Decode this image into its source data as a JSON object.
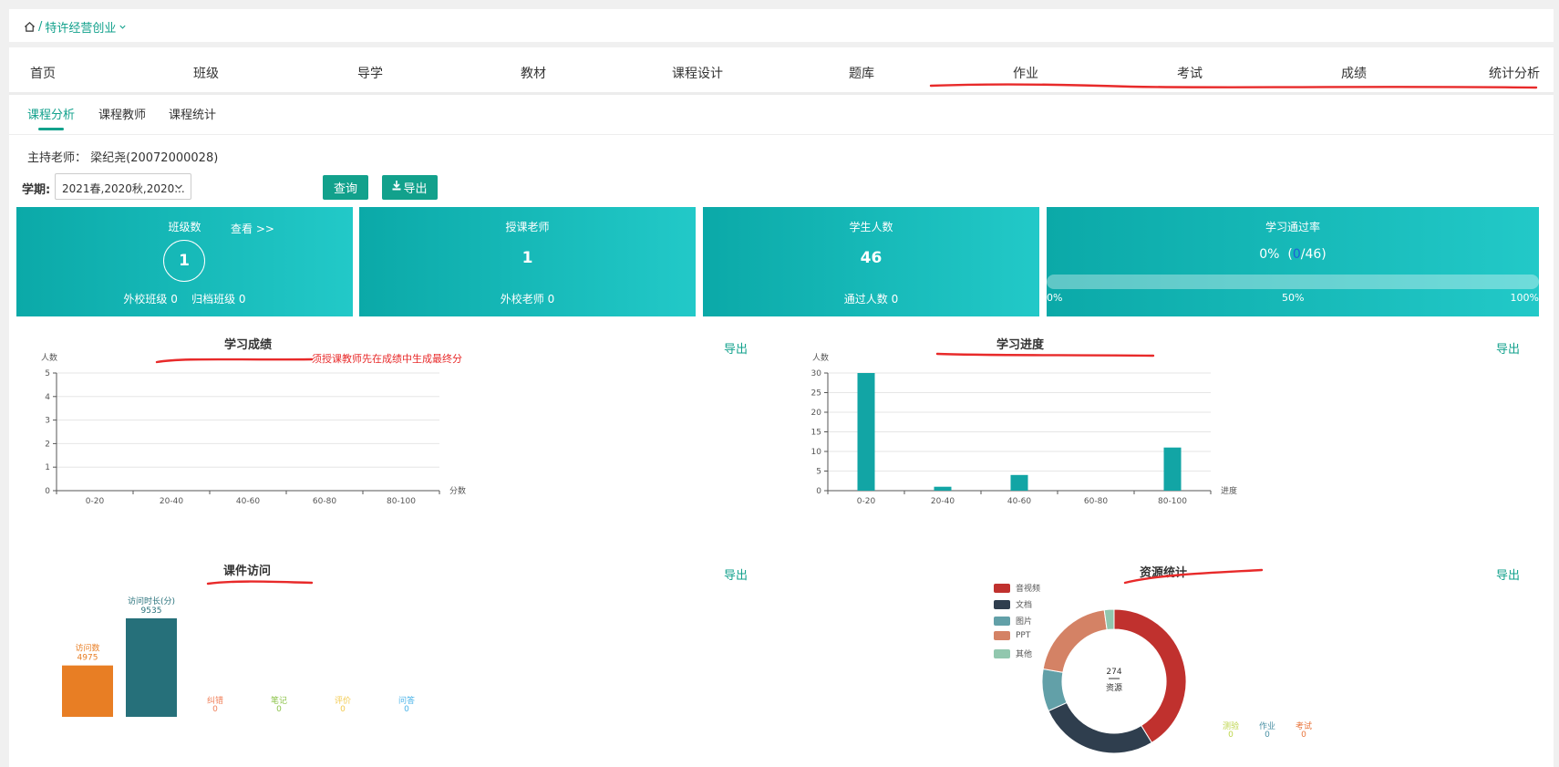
{
  "breadcrumb": {
    "separator": "/",
    "label": "特许经营创业"
  },
  "nav": [
    "首页",
    "班级",
    "导学",
    "教材",
    "课程设计",
    "题库",
    "作业",
    "考试",
    "成绩",
    "统计分析"
  ],
  "subnav": [
    "课程分析",
    "课程教师",
    "课程统计"
  ],
  "filters": {
    "host_label": "主持老师：",
    "host_value": "梁纪尧(20072000028)",
    "semester_label": "学期:",
    "semester_value": "2021春,2020秋,2020...",
    "query_button": "查询",
    "export_button": "导出"
  },
  "cards": {
    "classes": {
      "title": "班级数",
      "value": "1",
      "link": "查看 >>",
      "sub": "外校班级 0    归档班级 0"
    },
    "teachers": {
      "title": "授课老师",
      "value": "1",
      "sub": "外校老师 0"
    },
    "students": {
      "title": "学生人数",
      "value": "46",
      "sub": "通过人数 0"
    },
    "pass_rate": {
      "title": "学习通过率",
      "value_pre": "0%  (",
      "passed": "0",
      "value_post": "/46)",
      "ticks": [
        "0%",
        "50%",
        "100%"
      ],
      "progress": 0
    }
  },
  "charts": {
    "scores": {
      "title": "学习成绩",
      "export": "导出",
      "note": "须授课教师先在成绩中生成最终分"
    },
    "progress": {
      "title": "学习进度",
      "export": "导出"
    },
    "visits": {
      "title": "课件访问",
      "export": "导出"
    },
    "resources": {
      "title": "资源统计",
      "export": "导出"
    }
  },
  "chart_data": [
    {
      "type": "bar",
      "title": "学习成绩",
      "ylabel": "人数",
      "xlabel": "分数",
      "categories": [
        "0-20",
        "20-40",
        "40-60",
        "60-80",
        "80-100"
      ],
      "values": [
        0,
        0,
        0,
        0,
        0
      ],
      "yticks": [
        "0",
        "1",
        "2",
        "3",
        "4",
        "5"
      ],
      "ylim": [
        0,
        5
      ]
    },
    {
      "type": "bar",
      "title": "学习进度",
      "ylabel": "人数",
      "xlabel": "进度",
      "categories": [
        "0-20",
        "20-40",
        "40-60",
        "60-80",
        "80-100"
      ],
      "values": [
        30,
        1,
        4,
        0,
        11
      ],
      "yticks": [
        "0",
        "5",
        "10",
        "15",
        "20",
        "25",
        "30"
      ],
      "ylim": [
        0,
        30
      ],
      "color": "#12a5a5"
    },
    {
      "type": "bar",
      "title": "课件访问",
      "series": [
        {
          "name": "访问数",
          "value": 4975,
          "color": "#e87e24"
        },
        {
          "name": "访问时长(分)",
          "value": 9535,
          "color": "#26707a"
        },
        {
          "name": "纠错",
          "value": 0,
          "color": "#f0805a"
        },
        {
          "name": "笔记",
          "value": 0,
          "color": "#8cc34a"
        },
        {
          "name": "评价",
          "value": 0,
          "color": "#f2c94c"
        },
        {
          "name": "问答",
          "value": 0,
          "color": "#4ab3e8"
        }
      ]
    },
    {
      "type": "pie",
      "title": "资源统计",
      "center_value": "274",
      "center_label": "资源",
      "slices": [
        {
          "name": "音视频",
          "value": 113,
          "color": "#c0312e"
        },
        {
          "name": "文档",
          "value": 74,
          "color": "#2f3e4e"
        },
        {
          "name": "图片",
          "value": 26,
          "color": "#62a0a8"
        },
        {
          "name": "PPT",
          "value": 55,
          "color": "#d48265"
        },
        {
          "name": "其他",
          "value": 6,
          "color": "#91c7ae"
        }
      ],
      "extra_counts": [
        {
          "name": "测验",
          "value": "0",
          "color": "#bdd54a"
        },
        {
          "name": "作业",
          "value": "0",
          "color": "#4a90a4"
        },
        {
          "name": "考试",
          "value": "0",
          "color": "#e8743b"
        }
      ]
    }
  ]
}
